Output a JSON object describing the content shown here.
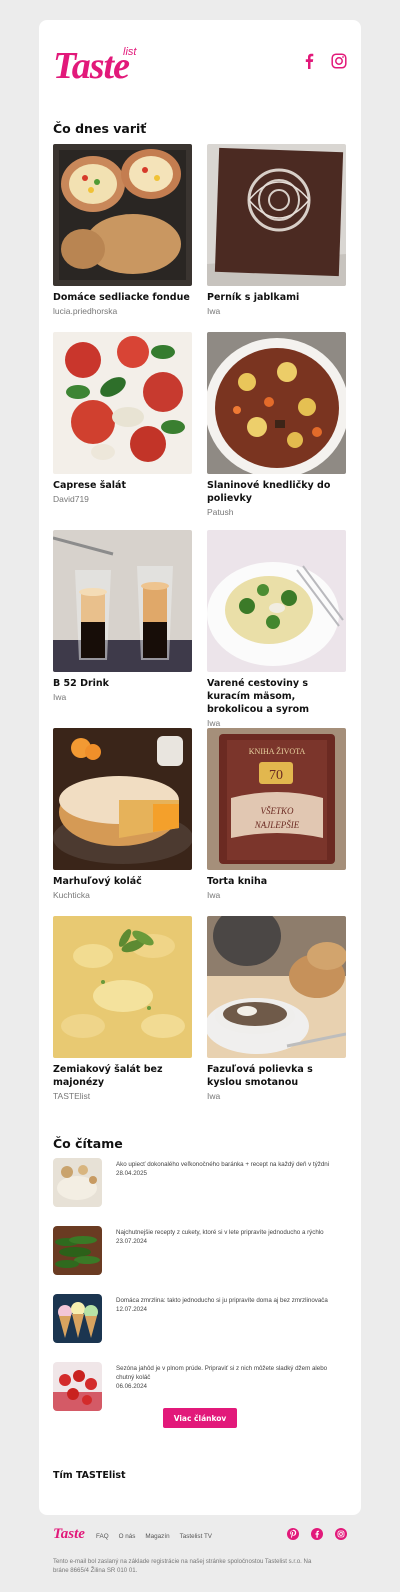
{
  "brand": {
    "logo_text": "Taste",
    "logo_suffix": "list",
    "accent": "#e2197a"
  },
  "social_top": [
    "facebook-icon",
    "instagram-icon"
  ],
  "section_recipes": "Čo dnes variť",
  "recipes": [
    {
      "title": "Domáce sedliacke fondue",
      "author": "lucia.priedhorska"
    },
    {
      "title": "Perník s jablkami",
      "author": "Iwa"
    },
    {
      "title": "Caprese šalát",
      "author": "David719"
    },
    {
      "title": "Slaninové knedličky do polievky",
      "author": "Patush"
    },
    {
      "title": "B 52 Drink",
      "author": "Iwa"
    },
    {
      "title": "Varené cestoviny s kuracím mäsom, brokolicou a syrom",
      "author": "Iwa"
    },
    {
      "title": "Marhuľový koláč",
      "author": "Kuchticka"
    },
    {
      "title": "Torta kniha",
      "author": "Iwa"
    },
    {
      "title": "Zemiakový šalát bez majonézy",
      "author": "TASTElist"
    },
    {
      "title": "Fazuľová polievka s kyslou smotanou",
      "author": "Iwa"
    }
  ],
  "section_articles": "Čo čítame",
  "articles": [
    {
      "title": "Ako upiecť dokonalého veľkonočného baránka + recept na každý deň v týždni",
      "date": "28.04.2025"
    },
    {
      "title": "Najchutnejšie recepty z cukety, ktoré si v lete pripravíte jednoducho a rýchlo",
      "date": "23.07.2024"
    },
    {
      "title": "Domáca zmrzlina: takto jednoducho si ju pripravíte doma aj bez zmrzlinovača",
      "date": "12.07.2024"
    },
    {
      "title": "Sezóna jahôd je v plnom prúde. Pripraviť si z nich môžete sladký džem alebo chutný koláč",
      "date": "06.06.2024"
    }
  ],
  "more_button": "Viac článkov",
  "signoff": "Tím TASTElist",
  "footer": {
    "logo_text": "Taste",
    "nav": [
      "FAQ",
      "O nás",
      "Magazín",
      "Tastelist TV"
    ],
    "social": [
      "pinterest-icon",
      "facebook-icon",
      "instagram-icon"
    ],
    "disclaimer": "Tento e-mail bol zaslaný na základe registrácie na našej stránke spoločnostou Tastelist s.r.o. Na bráne 8665/4 Žilina SR 010 01."
  }
}
